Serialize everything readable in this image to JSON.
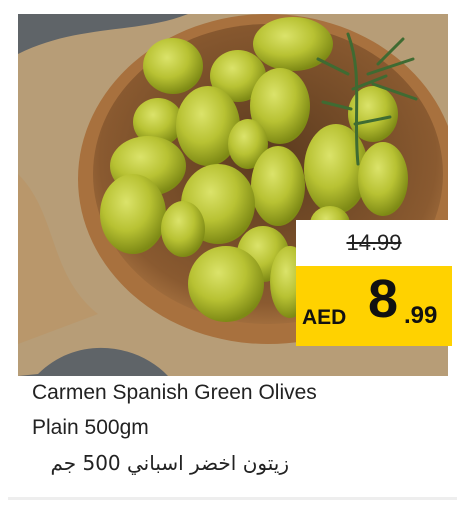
{
  "product": {
    "image_alt_icon": "olives-bowl-photo",
    "old_price": "14.99",
    "currency": "AED",
    "price_int": "8",
    "price_dec": ".99",
    "title_en_line1": "Carmen Spanish Green Olives",
    "title_en_line2": "Plain 500gm",
    "title_ar": "زيتون اخضر اسباني 500 جم"
  },
  "colors": {
    "badge_yellow": "#ffd200",
    "text_dark": "#222222"
  }
}
